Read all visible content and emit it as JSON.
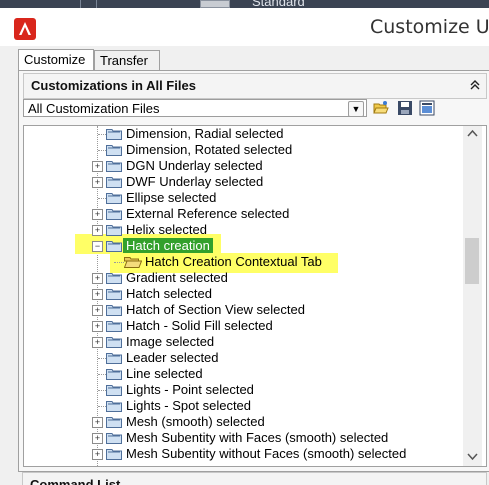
{
  "background_app": {
    "toolbar_text": "Standard"
  },
  "window": {
    "title": "Customize Use"
  },
  "tabs": [
    {
      "label": "Customize"
    },
    {
      "label": "Transfer"
    }
  ],
  "customizations_panel": {
    "title": "Customizations in All Files",
    "filter_value": "All Customization Files"
  },
  "tree": {
    "items": [
      {
        "label": "Dimension, Radial selected"
      },
      {
        "label": "Dimension, Rotated selected"
      },
      {
        "label": "DGN Underlay selected"
      },
      {
        "label": "DWF Underlay selected"
      },
      {
        "label": "Ellipse selected"
      },
      {
        "label": "External Reference selected"
      },
      {
        "label": "Helix selected"
      },
      {
        "label": "Hatch creation"
      },
      {
        "label": "Hatch Creation Contextual Tab"
      },
      {
        "label": "Gradient selected"
      },
      {
        "label": "Hatch selected"
      },
      {
        "label": "Hatch of Section View selected"
      },
      {
        "label": "Hatch - Solid Fill selected"
      },
      {
        "label": "Image selected"
      },
      {
        "label": "Leader selected"
      },
      {
        "label": "Line selected"
      },
      {
        "label": "Lights - Point selected"
      },
      {
        "label": "Lights - Spot selected"
      },
      {
        "label": "Mesh (smooth) selected"
      },
      {
        "label": "Mesh Subentity with Faces (smooth) selected"
      },
      {
        "label": "Mesh Subentity without Faces (smooth) selected"
      }
    ]
  },
  "bottom_panel": {
    "title": "Command List"
  },
  "colors": {
    "highlight": "#ffff66",
    "selection": "#33a02c",
    "autocad_red": "#d9261c"
  }
}
